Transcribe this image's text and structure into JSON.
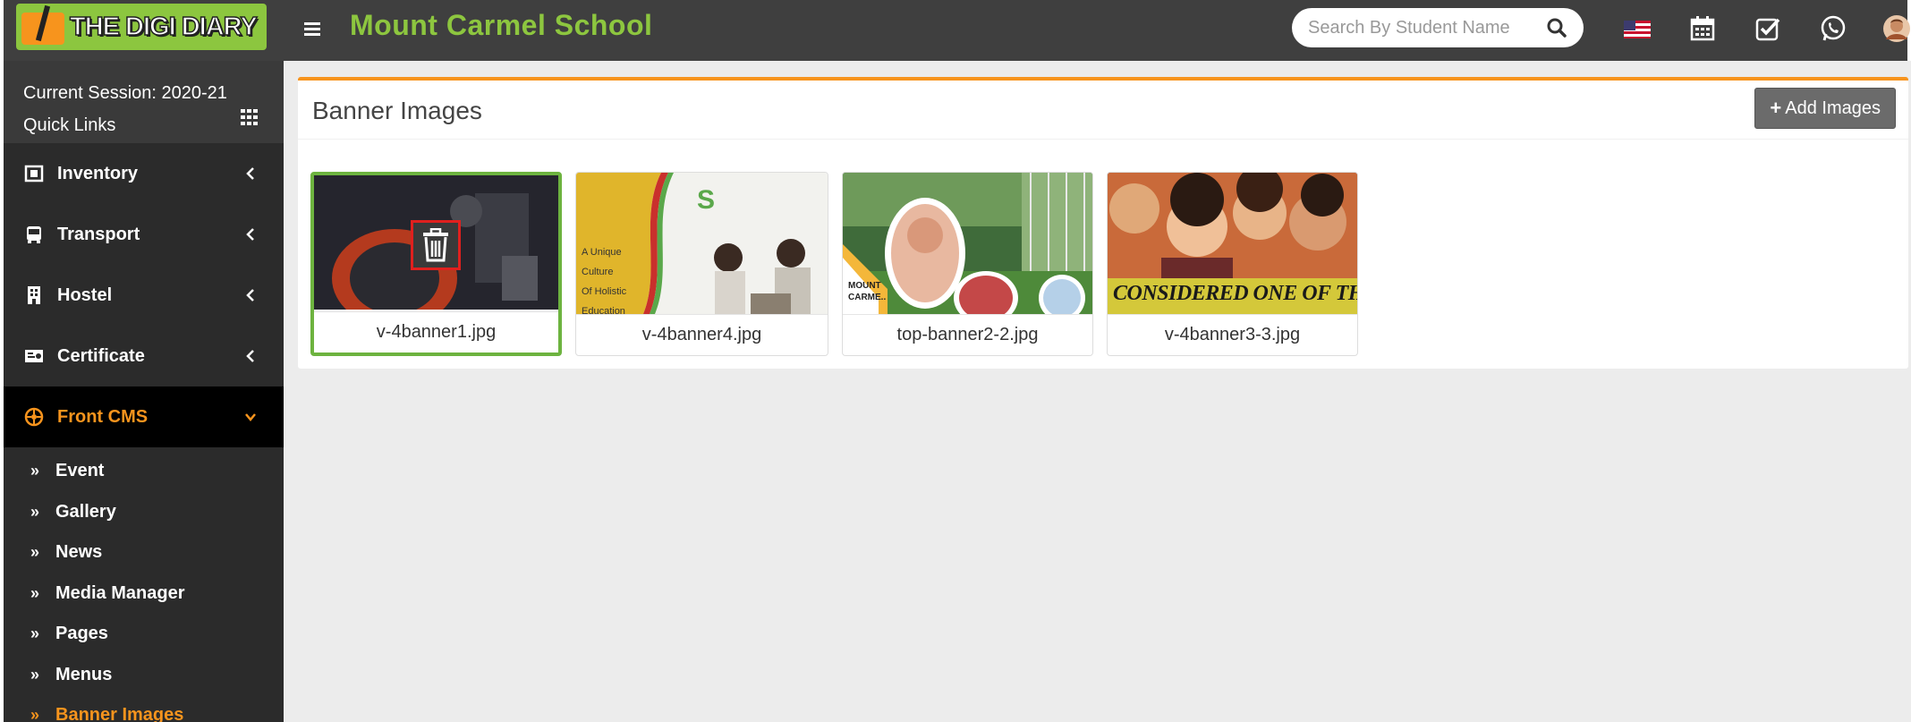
{
  "header": {
    "logo_text": "THE DIGI DIARY",
    "school_name": "Mount Carmel School",
    "search": {
      "placeholder": "Search By Student Name"
    },
    "icons": [
      "menu-icon",
      "search-icon",
      "us-flag-icon",
      "calendar-icon",
      "checkbox-icon",
      "whatsapp-icon",
      "avatar"
    ]
  },
  "sidebar": {
    "session": "Current Session: 2020-21",
    "quick_links": "Quick Links",
    "items": [
      {
        "label": "Inventory",
        "icon": "inventory-icon"
      },
      {
        "label": "Transport",
        "icon": "bus-icon"
      },
      {
        "label": "Hostel",
        "icon": "building-icon"
      },
      {
        "label": "Certificate",
        "icon": "certificate-icon"
      },
      {
        "label": "Front CMS",
        "icon": "cms-icon",
        "active": true
      }
    ],
    "sub_items": [
      {
        "label": "Event"
      },
      {
        "label": "Gallery"
      },
      {
        "label": "News"
      },
      {
        "label": "Media Manager"
      },
      {
        "label": "Pages"
      },
      {
        "label": "Menus"
      },
      {
        "label": "Banner Images",
        "active": true
      }
    ]
  },
  "main": {
    "title": "Banner Images",
    "add_button": "Add Images",
    "banners": [
      {
        "filename": "v-4banner1.jpg",
        "selected": true
      },
      {
        "filename": "v-4banner4.jpg",
        "text_lines": [
          "A Unique Culture",
          "Of Holistic",
          "Education Which"
        ]
      },
      {
        "filename": "top-banner2-2.jpg",
        "text_lines": [
          "MOUNT",
          "CARME.."
        ]
      },
      {
        "filename": "v-4banner3-3.jpg",
        "text_lines": [
          "CONSIDERED ONE OF THE TOP"
        ]
      }
    ]
  },
  "colors": {
    "topbar": "#3f3f3f",
    "sidebar": "#2b2b2b",
    "accent_orange": "#f7941d",
    "accent_green": "#8dc63f",
    "selected_border": "#6db33f",
    "delete_border": "#e0201e"
  }
}
